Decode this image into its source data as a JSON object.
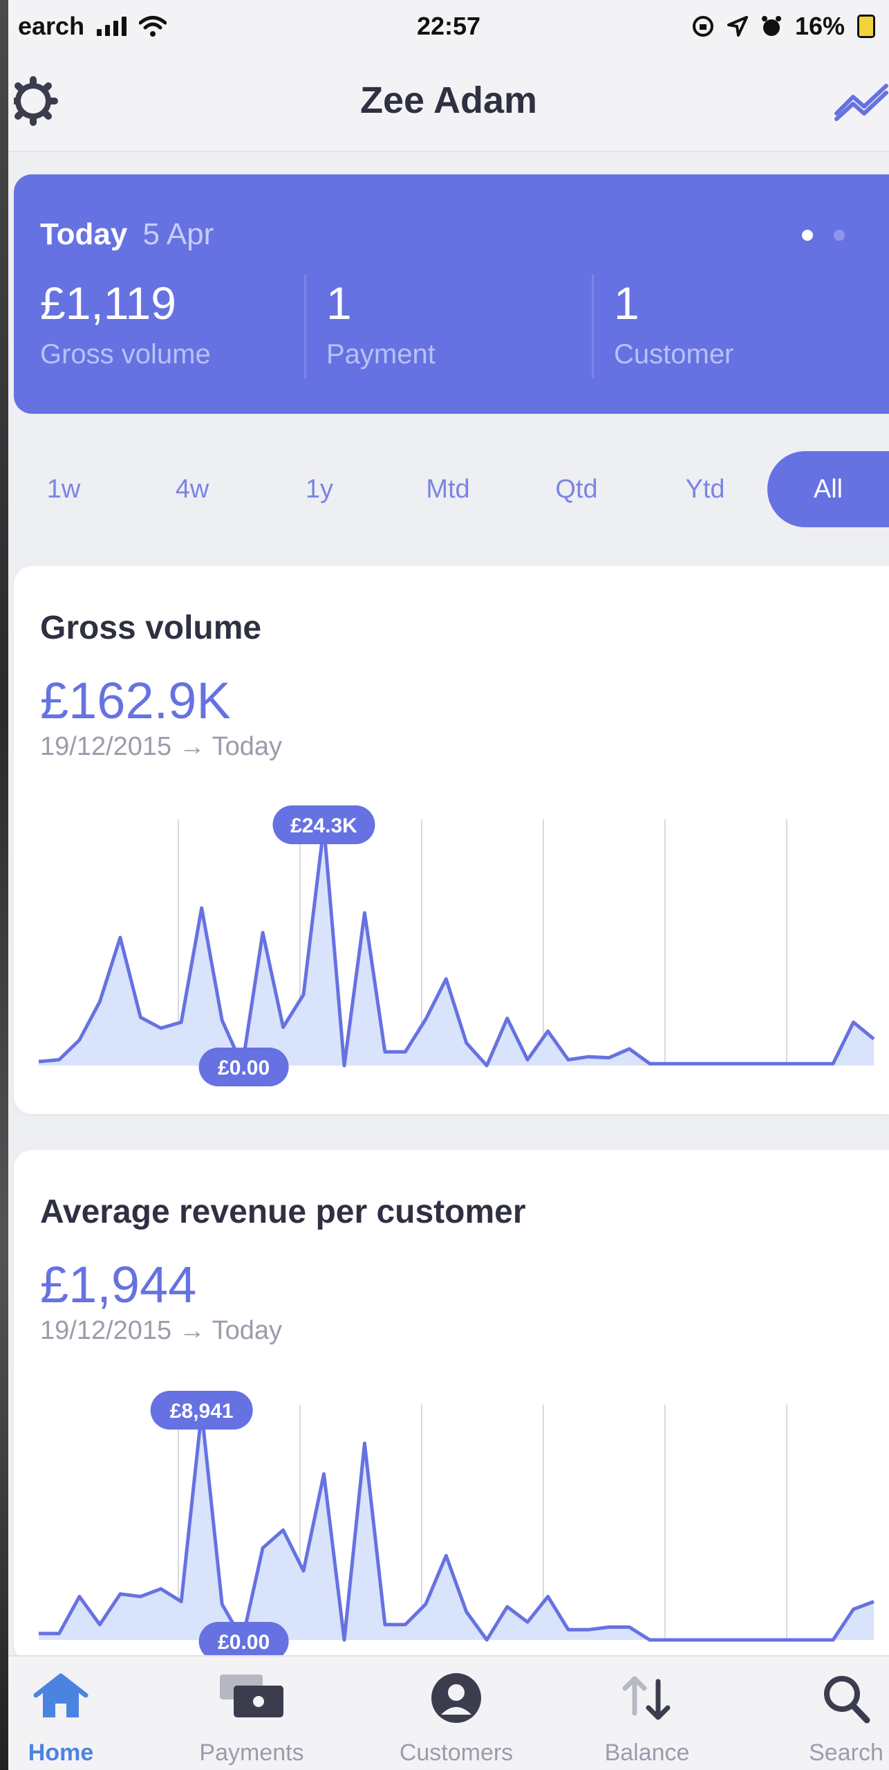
{
  "status": {
    "carrier": "earch",
    "time": "22:57",
    "battery": "16%",
    "battery_level": 0.16
  },
  "nav": {
    "title": "Zee Adam"
  },
  "summary": {
    "label": "Today",
    "date": "5 Apr",
    "metrics": [
      {
        "value": "£1,119",
        "label": "Gross volume"
      },
      {
        "value": "1",
        "label": "Payment"
      },
      {
        "value": "1",
        "label": "Customer"
      }
    ],
    "pages": 2,
    "active_page": 1
  },
  "ranges": [
    "1w",
    "4w",
    "1y",
    "Mtd",
    "Qtd",
    "Ytd",
    "All"
  ],
  "active_range": "All",
  "cards": [
    {
      "title": "Gross volume",
      "value": "£162.9K",
      "range": "19/12/2015 → Today",
      "max_label": "£24.3K",
      "min_label": "£0.00"
    },
    {
      "title": "Average revenue per customer",
      "value": "£1,944",
      "range": "19/12/2015 → Today",
      "max_label": "£8,941",
      "min_label": "£0.00"
    }
  ],
  "chart_data": [
    {
      "type": "area",
      "title": "Gross volume",
      "ylim": [
        0,
        24300
      ],
      "values": [
        400,
        600,
        2600,
        6500,
        13000,
        4900,
        3800,
        4400,
        16000,
        4600,
        0,
        13500,
        3900,
        7200,
        24300,
        0,
        15500,
        1400,
        1400,
        4700,
        8800,
        2300,
        0,
        4800,
        600,
        3500,
        600,
        900,
        800,
        1700,
        200,
        200,
        200,
        200,
        200,
        200,
        200,
        200,
        200,
        200,
        4400,
        2700
      ]
    },
    {
      "type": "area",
      "title": "Average revenue per customer",
      "ylim": [
        0,
        8941
      ],
      "values": [
        250,
        250,
        1700,
        600,
        1800,
        1700,
        2000,
        1500,
        8941,
        1400,
        0,
        3600,
        4300,
        2700,
        6500,
        0,
        7700,
        600,
        600,
        1400,
        3300,
        1100,
        0,
        1300,
        700,
        1700,
        400,
        400,
        500,
        500,
        0,
        0,
        0,
        0,
        0,
        0,
        0,
        0,
        0,
        0,
        1200,
        1500
      ]
    }
  ],
  "tabs": [
    {
      "label": "Home",
      "icon": "home-icon",
      "active": true
    },
    {
      "label": "Payments",
      "icon": "payments-icon",
      "active": false
    },
    {
      "label": "Customers",
      "icon": "customers-icon",
      "active": false
    },
    {
      "label": "Balance",
      "icon": "balance-icon",
      "active": false
    },
    {
      "label": "Search",
      "icon": "search-icon",
      "active": false
    }
  ],
  "colors": {
    "accent": "#6672e1",
    "fill": "#d9e3fb",
    "tab_active": "#4a84e0"
  }
}
